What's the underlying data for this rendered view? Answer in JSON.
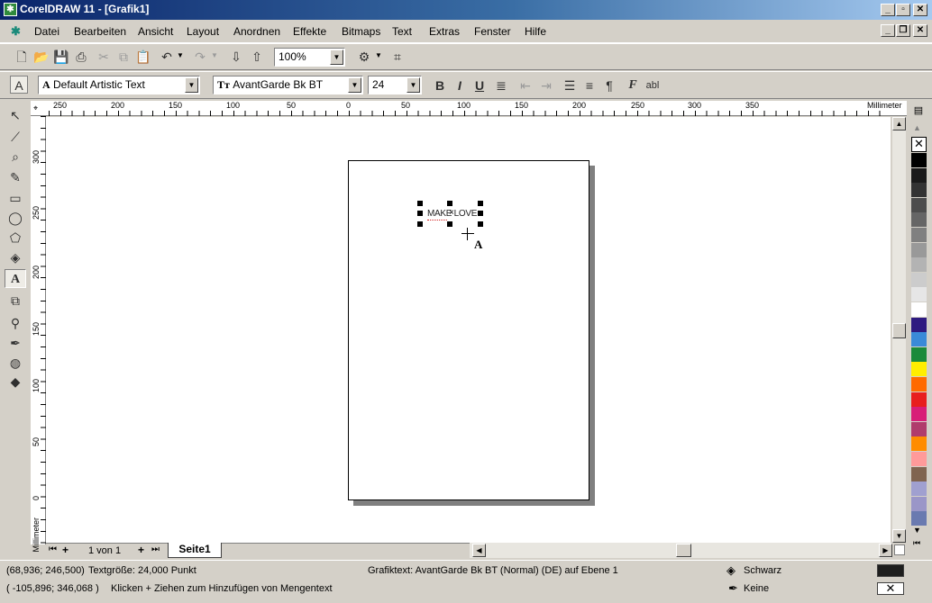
{
  "window": {
    "title": "CorelDRAW 11 - [Grafik1]",
    "app_icon": "coreldraw-icon"
  },
  "menu": [
    "Datei",
    "Bearbeiten",
    "Ansicht",
    "Layout",
    "Anordnen",
    "Effekte",
    "Bitmaps",
    "Text",
    "Extras",
    "Fenster",
    "Hilfe"
  ],
  "standard_toolbar": {
    "zoom": "100%"
  },
  "text_toolbar": {
    "style": "Default Artistic Text",
    "font": "AvantGarde Bk BT",
    "size": "24"
  },
  "ruler": {
    "h_ticks": [
      "250",
      "200",
      "150",
      "100",
      "50",
      "0",
      "50",
      "100",
      "150",
      "200",
      "250",
      "300",
      "350"
    ],
    "v_ticks": [
      "300",
      "250",
      "200",
      "150",
      "100",
      "50",
      "0"
    ],
    "unit": "Millimeter"
  },
  "document": {
    "text": "MAKE LOVE",
    "cursor_label": "A"
  },
  "page_nav": {
    "counter": "1 von 1",
    "tab": "Seite1"
  },
  "palette": [
    "#000000",
    "#1a1a1a",
    "#333333",
    "#4d4d4d",
    "#666666",
    "#808080",
    "#999999",
    "#b3b3b3",
    "#cccccc",
    "#e6e6e6",
    "#ffffff",
    "#2e1a80",
    "#3a8ad8",
    "#1a8a3a",
    "#ffee00",
    "#ff6a00",
    "#e81e1e",
    "#d81e78",
    "#b03c6c",
    "#ff8c00",
    "#ff9a9a",
    "#806450",
    "#a0a0d0",
    "#9a96c8",
    "#6a7ab0"
  ],
  "status": {
    "coords1": "(68,936; 246,500)",
    "text_size": "Textgröße: 24,000 Punkt",
    "object_info": "Grafiktext: AvantGarde Bk BT (Normal) (DE) auf Ebene 1",
    "coords2": "( -105,896; 346,068 )",
    "hint": "Klicken + Ziehen zum Hinzufügen von Mengentext",
    "fill_label": "Schwarz",
    "outline_label": "Keine",
    "fill_color": "#1e1e1e"
  }
}
